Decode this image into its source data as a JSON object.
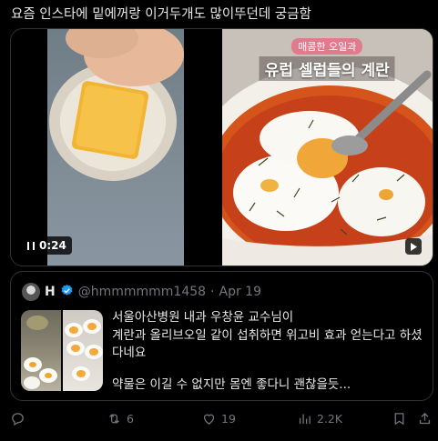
{
  "post": {
    "text": "요즘 인스타에 밑에꺼랑 이거두개도 많이뚜던데 궁금함"
  },
  "media": {
    "left_video": {
      "duration": "0:24"
    },
    "right_video": {
      "tag": "매콤한 오일과",
      "title": "유럽 셀럽들의 계란"
    }
  },
  "quote": {
    "name": "H",
    "handle": "@hmmmmmm1458",
    "separator": "·",
    "date": "Apr 19",
    "lines": [
      "서울아산병원 내과 우창윤 교수님이",
      "계란과 올리브오일 같이 섭취하면 위고비 효과 얻는다고 하셨",
      "다네요",
      "약물은 이길 수 없지만 몸엔 좋다니 괜찮을듯..."
    ]
  },
  "actions": {
    "replies": "",
    "reposts": "6",
    "likes": "19",
    "views": "2.2K"
  },
  "icons": [
    "reply-icon",
    "repost-icon",
    "like-icon",
    "views-icon",
    "bookmark-icon",
    "share-icon",
    "verified-icon",
    "play-icon",
    "pause-icon"
  ],
  "colors": {
    "background": "#000000",
    "text": "#e7e9ea",
    "secondary_text": "#71767b",
    "border": "#2f3336",
    "verified": "#1d9bf0"
  }
}
